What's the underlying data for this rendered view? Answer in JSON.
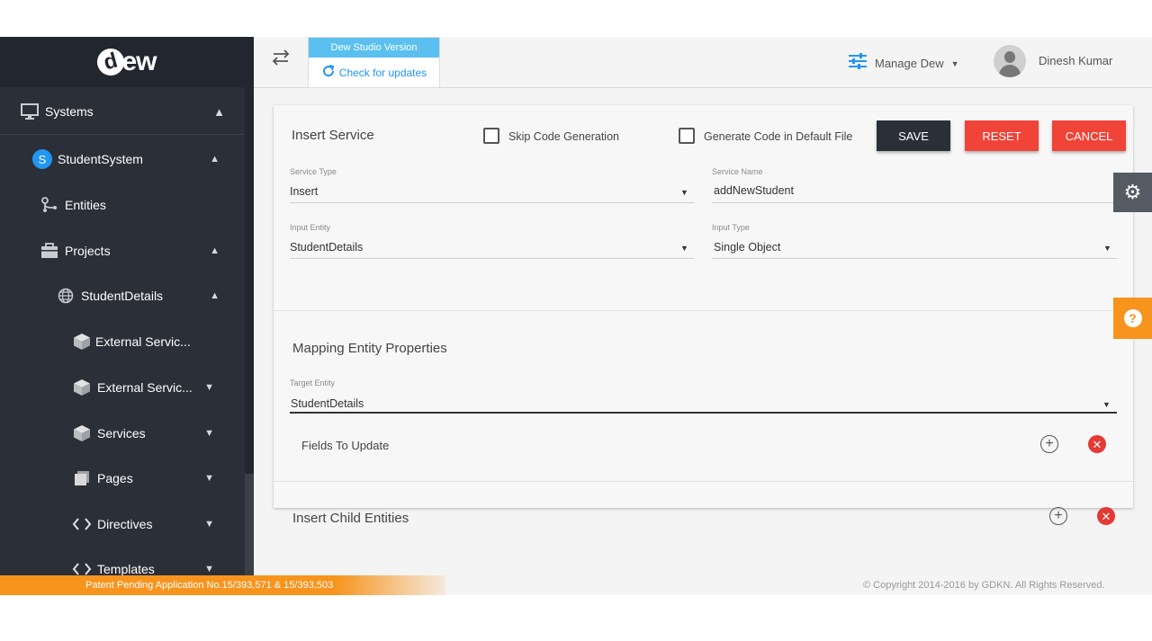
{
  "app": {
    "logo_text": "ew",
    "logo_badge": "d"
  },
  "sidebar": {
    "items": [
      {
        "label": "Systems",
        "icon": "monitor-icon",
        "caret": "▲"
      },
      {
        "label": "StudentSystem",
        "icon": "s-badge",
        "badge": "S",
        "caret": "▲"
      },
      {
        "label": "Entities",
        "icon": "entities-icon"
      },
      {
        "label": "Projects",
        "icon": "briefcase-icon",
        "caret": "▲"
      },
      {
        "label": "StudentDetails",
        "icon": "globe-icon",
        "caret": "▲"
      },
      {
        "label": "External Servic...",
        "icon": "cube-icon"
      },
      {
        "label": "External Servic...",
        "icon": "cube-icon",
        "caret": "▼"
      },
      {
        "label": "Services",
        "icon": "cube-icon",
        "caret": "▼"
      },
      {
        "label": "Pages",
        "icon": "pages-icon",
        "caret": "▼"
      },
      {
        "label": "Directives",
        "icon": "code-icon",
        "caret": "▼"
      },
      {
        "label": "Templates",
        "icon": "code-icon",
        "caret": "▼"
      }
    ]
  },
  "topbar": {
    "version_title": "Dew Studio Version",
    "check_updates": "Check for updates",
    "manage": "Manage Dew",
    "username": "Dinesh Kumar"
  },
  "form": {
    "title": "Insert Service",
    "skip_code": "Skip Code Generation",
    "default_file": "Generate Code in Default File",
    "save": "SAVE",
    "reset": "RESET",
    "cancel": "CANCEL",
    "service_type_label": "Service Type",
    "service_type_value": "Insert",
    "service_name_label": "Service Name",
    "service_name_value": "addNewStudent",
    "input_entity_label": "Input Entity",
    "input_entity_value": "StudentDetails",
    "input_type_label": "Input Type",
    "input_type_value": "Single Object",
    "mapping_title": "Mapping Entity Properties",
    "target_entity_label": "Target Entity",
    "target_entity_value": "StudentDetails",
    "fields_to_update": "Fields To Update",
    "insert_child": "Insert Child Entities"
  },
  "footer": {
    "patent": "Patent Pending Application No.15/393,571 & 15/393,503",
    "copyright": "© Copyright 2014-2016 by GDKN. All Rights Reserved."
  },
  "colors": {
    "sidebar": "#2b2f38",
    "accent": "#2196f3",
    "danger": "#f04438",
    "orange": "#f7941d"
  }
}
